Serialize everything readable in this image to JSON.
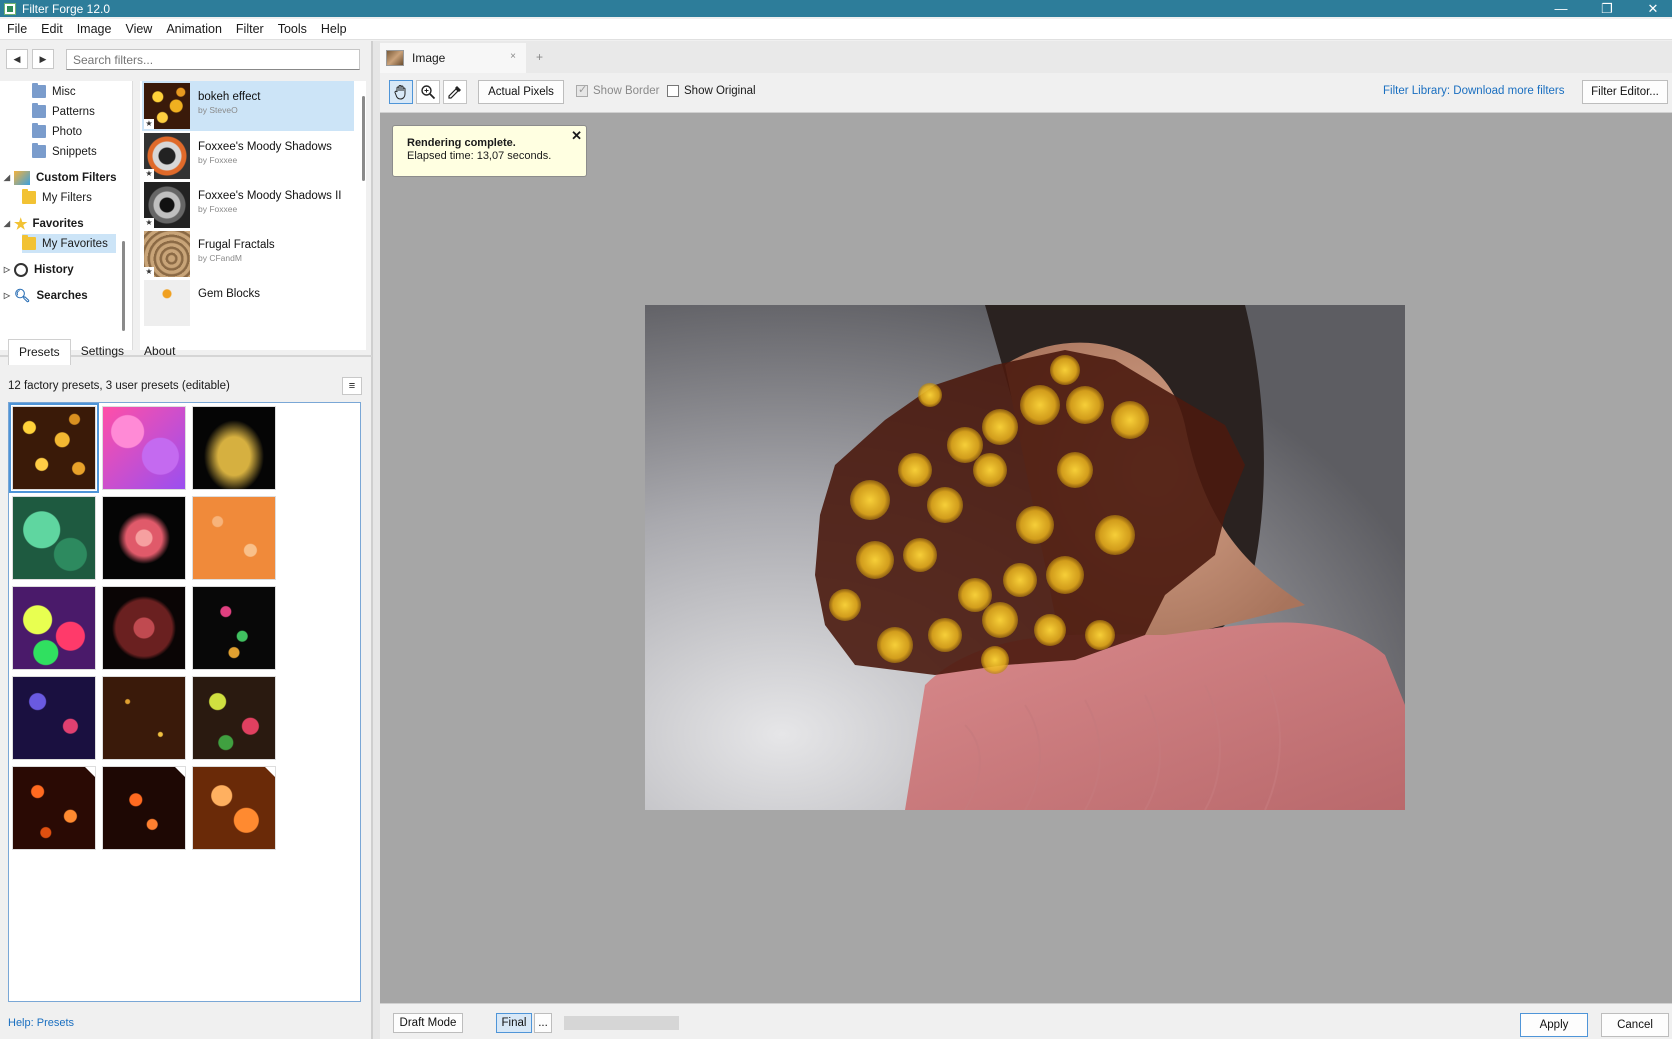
{
  "window": {
    "title": "Filter Forge 12.0",
    "controls": [
      "—",
      "❐",
      "✕"
    ]
  },
  "menu": [
    "File",
    "Edit",
    "Image",
    "View",
    "Animation",
    "Filter",
    "Tools",
    "Help"
  ],
  "search": {
    "placeholder": "Search filters..."
  },
  "tree": {
    "items": [
      {
        "label": "Misc"
      },
      {
        "label": "Patterns"
      },
      {
        "label": "Photo"
      },
      {
        "label": "Snippets"
      },
      {
        "label": "Custom Filters"
      },
      {
        "label": "My Filters"
      },
      {
        "label": "Favorites"
      },
      {
        "label": "My Favorites"
      },
      {
        "label": "History"
      },
      {
        "label": "Searches"
      }
    ]
  },
  "filters": [
    {
      "name": "bokeh effect",
      "author": "by SteveO"
    },
    {
      "name": "Foxxee's Moody Shadows",
      "author": "by Foxxee"
    },
    {
      "name": "Foxxee's Moody Shadows II",
      "author": "by Foxxee"
    },
    {
      "name": "Frugal Fractals",
      "author": "by CFandM"
    },
    {
      "name": "Gem Blocks",
      "author": ""
    }
  ],
  "panel_tabs": [
    "Presets",
    "Settings",
    "About"
  ],
  "presets_summary": "12 factory presets, 3 user presets (editable)",
  "help_link": "Help: Presets",
  "doc": {
    "tab_label": "Image",
    "tab_close": "×",
    "new_tab": "+"
  },
  "toolbar": {
    "actual_pixels": "Actual Pixels",
    "show_border": "Show Border",
    "show_border_checked": true,
    "show_original": "Show Original",
    "show_original_checked": false,
    "library_link": "Filter Library: Download more filters",
    "filter_editor": "Filter Editor..."
  },
  "toast": {
    "title": "Rendering complete.",
    "message": "Elapsed time: 13,07 seconds.",
    "close": "✕"
  },
  "status": {
    "draft_mode": "Draft Mode",
    "final": "Final",
    "more": "...",
    "apply": "Apply",
    "cancel": "Cancel"
  },
  "colors": {
    "title_bar": "#2d7d9a",
    "link": "#1a6fc0",
    "selection": "#cce4f7",
    "canvas_bg": "#a6a6a6"
  }
}
